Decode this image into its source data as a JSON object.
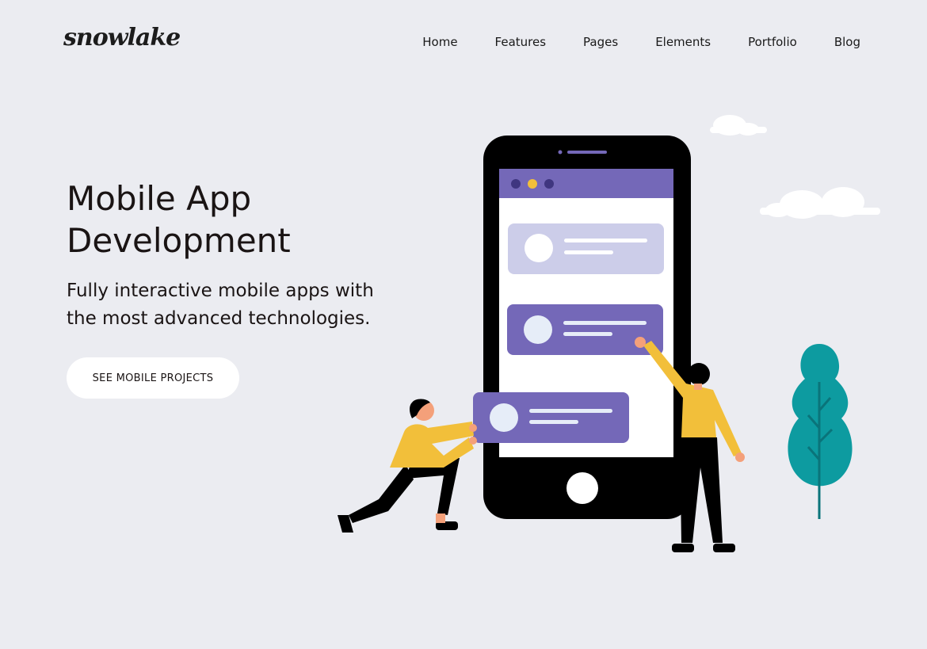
{
  "brand": {
    "logo_text": "snowlake"
  },
  "nav": {
    "items": [
      "Home",
      "Features",
      "Pages",
      "Elements",
      "Portfolio",
      "Blog"
    ]
  },
  "hero": {
    "title": "Mobile App Development",
    "subtitle": "Fully interactive mobile apps with the most advanced technologies.",
    "cta_label": "SEE MOBILE PROJECTS"
  },
  "colors": {
    "background": "#ebecf1",
    "accent_purple": "#7468b8",
    "light_purple": "#cccde9",
    "yellow": "#f2bf3a",
    "teal": "#0d9ba0"
  }
}
